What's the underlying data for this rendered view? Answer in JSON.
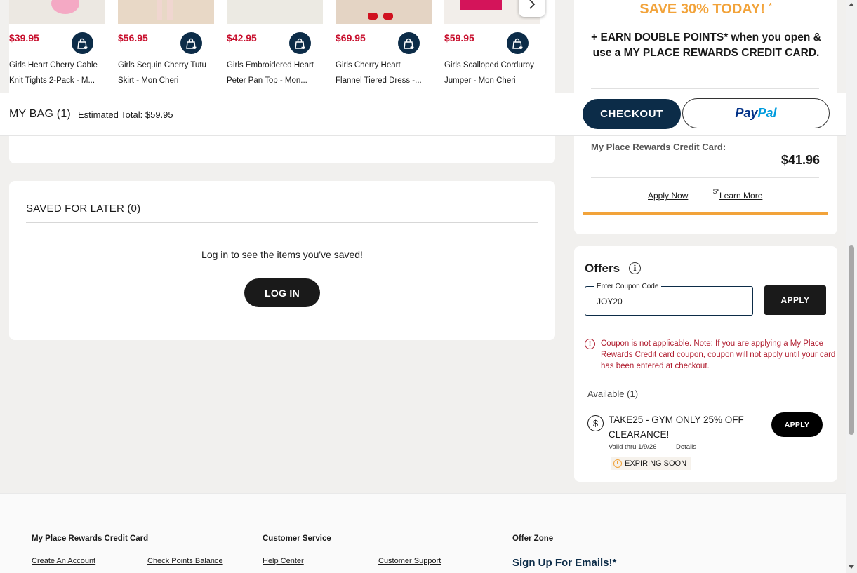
{
  "recommendations": [
    {
      "price": "$39.95",
      "name_line1": "Girls Heart Cherry Cable",
      "name_line2": "Knit Tights 2-Pack - M..."
    },
    {
      "price": "$56.95",
      "name_line1": "Girls Sequin Cherry Tutu",
      "name_line2": "Skirt - Mon Cheri"
    },
    {
      "price": "$42.95",
      "name_line1": "Girls Embroidered Heart",
      "name_line2": "Peter Pan Top - Mon..."
    },
    {
      "price": "$69.95",
      "name_line1": "Girls Cherry Heart",
      "name_line2": "Flannel Tiered Dress -..."
    },
    {
      "price": "$59.95",
      "name_line1": "Girls Scalloped Corduroy",
      "name_line2": "Jumper - Mon Cheri"
    }
  ],
  "bag_bar": {
    "title": "MY BAG (1)",
    "estimated_total": "Estimated Total: $59.95",
    "checkout_label": "CHECKOUT",
    "paypal_part1": "Pay",
    "paypal_part2": "Pal"
  },
  "promo": {
    "save_text": "SAVE 30% TODAY!",
    "save_mark": "*",
    "earn_text": "+ EARN DOUBLE POINTS* when you open & use a MY PLACE REWARDS CREDIT CARD."
  },
  "rewards": {
    "label": "My Place Rewards Credit Card:",
    "amount": "$41.96",
    "apply_now": "Apply Now",
    "learn_more_prefix": "$*",
    "learn_more": "Learn More"
  },
  "saved_for_later": {
    "title": "SAVED FOR LATER (0)",
    "message": "Log in to see the items you've saved!",
    "login_label": "LOG IN"
  },
  "offers": {
    "title": "Offers",
    "coupon_label": "Enter Coupon Code",
    "coupon_value": "JOY20",
    "apply_label": "APPLY",
    "error": "Coupon is not applicable. Note: If you are applying a My Place Rewards Credit card coupon, coupon will not apply until your card has been entered at checkout.",
    "available": "Available (1)",
    "offer_title": "TAKE25 - GYM ONLY 25% OFF CLEARANCE!",
    "valid": "Valid thru 1/9/26",
    "details": "Details",
    "expiring": "EXPIRING SOON",
    "offer_apply_label": "APPLY"
  },
  "footer": {
    "col1_title": "My Place Rewards Credit Card",
    "col1_link1": "Create An Account",
    "col1_link2": "Check Points Balance",
    "col2_title": "Customer Service",
    "col2_link1": "Help Center",
    "col2_link2": "Customer Support",
    "col3_title": "Offer Zone",
    "signup": "Sign Up For Emails!*"
  },
  "colors": {
    "navy": "#0c2c48",
    "price_red": "#c8102e",
    "promo_orange": "#f2a33a",
    "error_red": "#b01c2e"
  }
}
